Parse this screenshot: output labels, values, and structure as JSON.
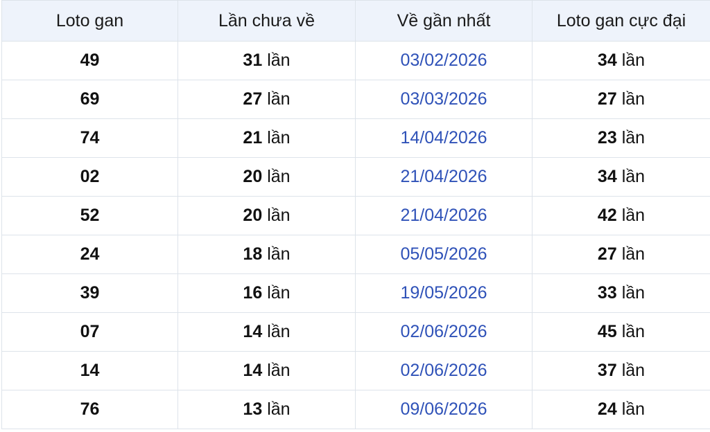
{
  "table": {
    "headers": [
      "Loto gan",
      "Lần chưa về",
      "Về gần nhất",
      "Loto gan cực đại"
    ],
    "rows": [
      {
        "number": "49",
        "missed": "31",
        "unit": "lần",
        "last_date": "03/02/2026",
        "max_gan": "34",
        "max_unit": "lần"
      },
      {
        "number": "69",
        "missed": "27",
        "unit": "lần",
        "last_date": "03/03/2026",
        "max_gan": "27",
        "max_unit": "lần"
      },
      {
        "number": "74",
        "missed": "21",
        "unit": "lần",
        "last_date": "14/04/2026",
        "max_gan": "23",
        "max_unit": "lần"
      },
      {
        "number": "02",
        "missed": "20",
        "unit": "lần",
        "last_date": "21/04/2026",
        "max_gan": "34",
        "max_unit": "lần"
      },
      {
        "number": "52",
        "missed": "20",
        "unit": "lần",
        "last_date": "21/04/2026",
        "max_gan": "42",
        "max_unit": "lần"
      },
      {
        "number": "24",
        "missed": "18",
        "unit": "lần",
        "last_date": "05/05/2026",
        "max_gan": "27",
        "max_unit": "lần"
      },
      {
        "number": "39",
        "missed": "16",
        "unit": "lần",
        "last_date": "19/05/2026",
        "max_gan": "33",
        "max_unit": "lần"
      },
      {
        "number": "07",
        "missed": "14",
        "unit": "lần",
        "last_date": "02/06/2026",
        "max_gan": "45",
        "max_unit": "lần"
      },
      {
        "number": "14",
        "missed": "14",
        "unit": "lần",
        "last_date": "02/06/2026",
        "max_gan": "37",
        "max_unit": "lần"
      },
      {
        "number": "76",
        "missed": "13",
        "unit": "lần",
        "last_date": "09/06/2026",
        "max_gan": "24",
        "max_unit": "lần"
      }
    ]
  },
  "colors": {
    "header_bg": "#eef3fb",
    "date_text": "#2f52b8",
    "border": "#dde3ea"
  }
}
